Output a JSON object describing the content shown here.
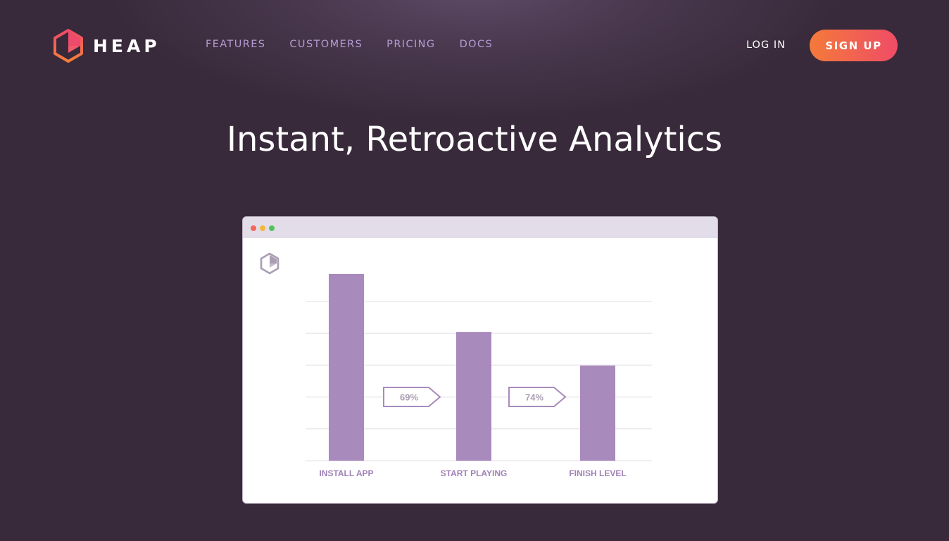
{
  "brand": {
    "name": "HEAP"
  },
  "nav": {
    "links": [
      {
        "label": "FEATURES"
      },
      {
        "label": "CUSTOMERS"
      },
      {
        "label": "PRICING"
      },
      {
        "label": "DOCS"
      }
    ],
    "login_label": "LOG IN",
    "signup_label": "SIGN UP"
  },
  "hero": {
    "title": "Instant, Retroactive Analytics"
  },
  "colors": {
    "background": "#392a3b",
    "nav_link": "#b69bd3",
    "accent_start": "#f47a3b",
    "accent_end": "#ef4c66",
    "bar": "#a98abc",
    "bar_label": "#9f82b6"
  },
  "illustration": {
    "window_dots": [
      "#f2665c",
      "#f5b73b",
      "#52c35b"
    ],
    "mini_logo_icon": "heap-hexagon-icon"
  },
  "chart_data": {
    "type": "bar",
    "categories": [
      "INSTALL APP",
      "START PLAYING",
      "FINISH LEVEL"
    ],
    "values": [
      100,
      69,
      51
    ],
    "conversions": [
      "69%",
      "74%"
    ],
    "ylim": [
      0,
      100
    ],
    "grid": true,
    "title": "",
    "xlabel": "",
    "ylabel": ""
  }
}
